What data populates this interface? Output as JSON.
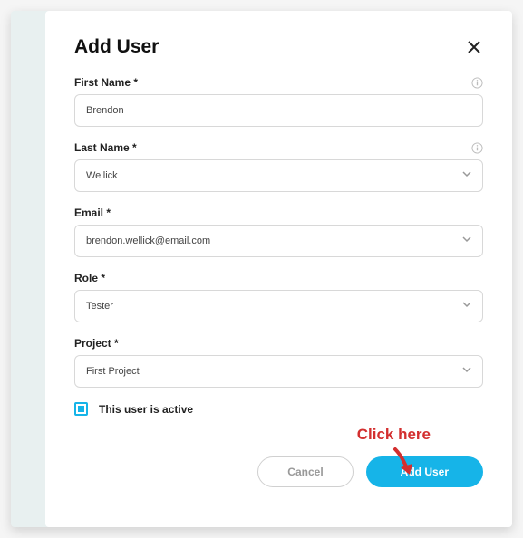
{
  "modal": {
    "title": "Add User",
    "fields": {
      "firstName": {
        "label": "First Name *",
        "value": "Brendon"
      },
      "lastName": {
        "label": "Last Name *",
        "value": "Wellick"
      },
      "email": {
        "label": "Email *",
        "value": "brendon.wellick@email.com"
      },
      "role": {
        "label": "Role *",
        "value": "Tester"
      },
      "project": {
        "label": "Project *",
        "value": "First Project"
      }
    },
    "activeCheckbox": {
      "label": "This user is active",
      "checked": true
    },
    "buttons": {
      "cancel": "Cancel",
      "submit": "Add User"
    }
  },
  "annotation": {
    "text": "Click here"
  }
}
